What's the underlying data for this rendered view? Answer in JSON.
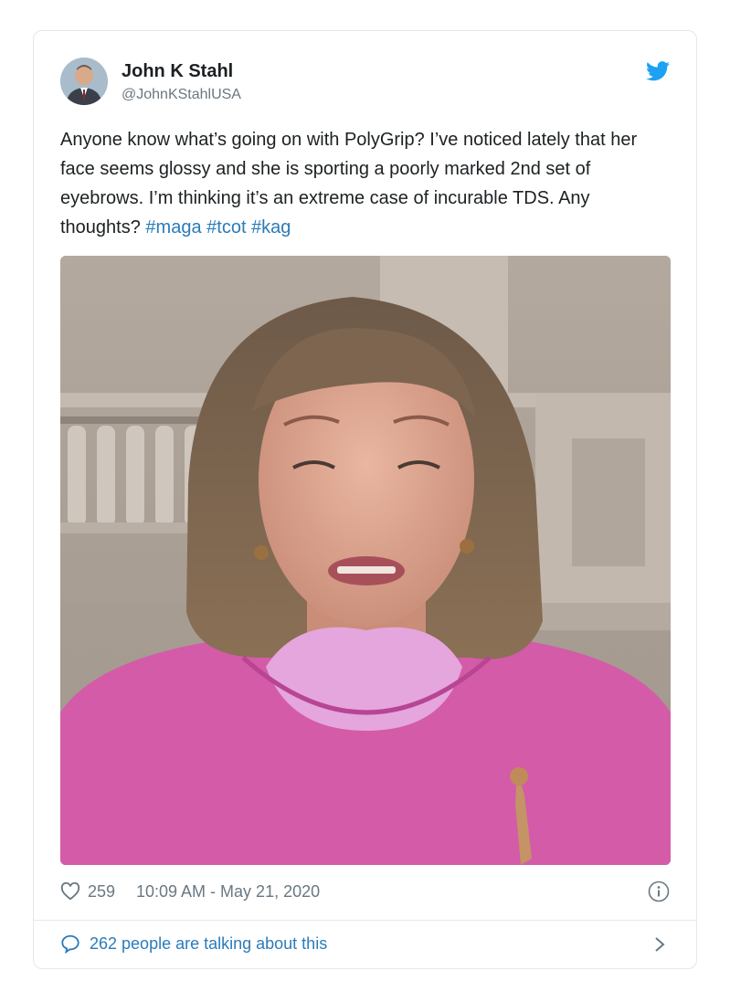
{
  "tweet": {
    "author": {
      "display_name": "John K Stahl",
      "handle": "@JohnKStahlUSA",
      "avatar_icon": "user-avatar"
    },
    "brand_icon": "twitter-bird-icon",
    "text_plain": "Anyone know what’s going on with PolyGrip? I’ve noticed lately that her face seems glossy and she is sporting a poorly marked 2nd set of eyebrows. I’m thinking it’s an extreme case of incurable TDS. Any thoughts? ",
    "hashtags": [
      "#maga",
      "#tcot",
      "#kag"
    ],
    "likes": "259",
    "timestamp": "10:09 AM - May 21, 2020",
    "talking_text": "262 people are talking about this"
  },
  "colors": {
    "link": "#2b7bb9",
    "muted": "#697882",
    "twitter_blue": "#1da1f2",
    "border": "#e1e8ed"
  }
}
